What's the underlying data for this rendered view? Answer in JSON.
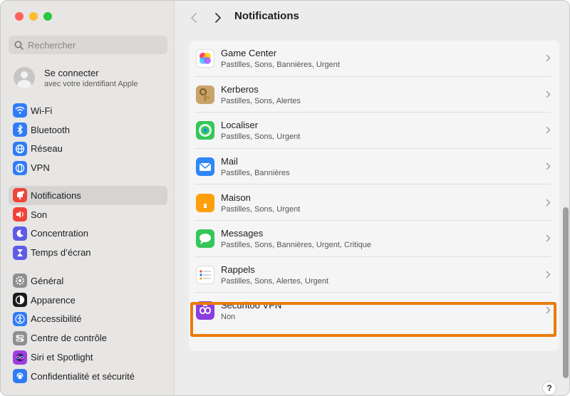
{
  "window": {
    "title": "Notifications",
    "search_placeholder": "Rechercher"
  },
  "account": {
    "title": "Se connecter",
    "subtitle": "avec votre identifiant Apple"
  },
  "sidebar": {
    "group1": [
      {
        "label": "Wi-Fi",
        "icon": "wifi-icon",
        "color": "#2f7cf6"
      },
      {
        "label": "Bluetooth",
        "icon": "bluetooth-icon",
        "color": "#2f7cf6"
      },
      {
        "label": "Réseau",
        "icon": "network-icon",
        "color": "#2f7cf6"
      },
      {
        "label": "VPN",
        "icon": "vpn-icon",
        "color": "#2f7cf6"
      }
    ],
    "group2": [
      {
        "label": "Notifications",
        "icon": "notifications-icon",
        "color": "#f0433a",
        "active": true
      },
      {
        "label": "Son",
        "icon": "sound-icon",
        "color": "#f0433a"
      },
      {
        "label": "Concentration",
        "icon": "focus-icon",
        "color": "#5e5ce6"
      },
      {
        "label": "Temps d’écran",
        "icon": "screen-time-icon",
        "color": "#5e5ce6"
      }
    ],
    "group3": [
      {
        "label": "Général",
        "icon": "general-icon",
        "color": "#8e8e93"
      },
      {
        "label": "Apparence",
        "icon": "appearance-icon",
        "color": "#1c1c1e"
      },
      {
        "label": "Accessibilité",
        "icon": "accessibility-icon",
        "color": "#2f7cf6"
      },
      {
        "label": "Centre de contrôle",
        "icon": "control-center-icon",
        "color": "#8e8e93"
      },
      {
        "label": "Siri et Spotlight",
        "icon": "siri-icon",
        "color": "#a03ee0"
      },
      {
        "label": "Confidentialité et sécurité",
        "icon": "privacy-icon",
        "color": "#2f7cf6"
      }
    ]
  },
  "apps": [
    {
      "name": "Game Center",
      "detail": "Pastilles, Sons, Bannières, Urgent",
      "icon": "game-center-icon",
      "color": "#ffffff"
    },
    {
      "name": "Kerberos",
      "detail": "Pastilles, Sons, Alertes",
      "icon": "kerberos-icon",
      "color": "#c9a46a"
    },
    {
      "name": "Localiser",
      "detail": "Pastilles, Sons, Urgent",
      "icon": "find-my-icon",
      "color": "#34c759"
    },
    {
      "name": "Mail",
      "detail": "Pastilles, Bannières",
      "icon": "mail-icon",
      "color": "#2f86f6"
    },
    {
      "name": "Maison",
      "detail": "Pastilles, Sons, Urgent",
      "icon": "home-icon",
      "color": "#ff9f0a"
    },
    {
      "name": "Messages",
      "detail": "Pastilles, Sons, Bannières, Urgent, Critique",
      "icon": "messages-icon",
      "color": "#34c759"
    },
    {
      "name": "Rappels",
      "detail": "Pastilles, Sons, Alertes, Urgent",
      "icon": "reminders-icon",
      "color": "#ffffff"
    },
    {
      "name": "Securitoo VPN",
      "detail": "Non",
      "icon": "securitoo-vpn-icon",
      "color": "#8a3fe0"
    }
  ],
  "help_label": "?",
  "accent_highlight": "#e97c0a"
}
